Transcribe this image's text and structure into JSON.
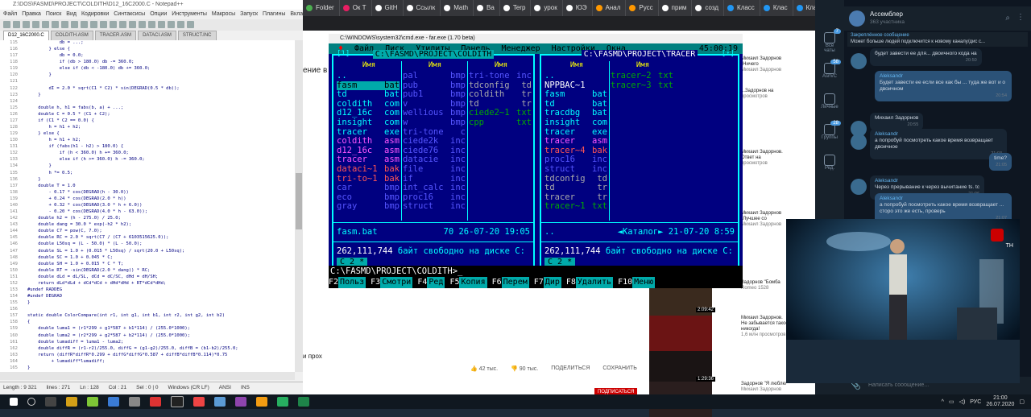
{
  "editor": {
    "title": "Z:\\DOS\\FASMD\\PROJECT\\COLDITH\\D12_16C2000.C - Notepad++",
    "menu": [
      "Файл",
      "Правка",
      "Поиск",
      "Вид",
      "Кодировки",
      "Синтаксисы",
      "Опции",
      "Инструменты",
      "Макросы",
      "Запуск",
      "Плагины",
      "Вкладки",
      "?"
    ],
    "tabs": [
      "D12_16C2000.C",
      "COLDITH.ASM",
      "TRACER.ASM",
      "DATACI.ASM",
      "STRUCT.INC"
    ],
    "lines": [
      {
        "n": "115",
        "t": "            db = ...;"
      },
      {
        "n": "116",
        "t": "        } else {"
      },
      {
        "n": "117",
        "t": "            db = 0.0;"
      },
      {
        "n": "118",
        "t": "            if (db > 180.0) db -= 360.0;"
      },
      {
        "n": "119",
        "t": "            else if (db < -180.0) db += 360.0;"
      },
      {
        "n": "120",
        "t": "        }"
      },
      {
        "n": "121",
        "t": ""
      },
      {
        "n": "122",
        "t": "        dI = 2.0 * sqrt(C1 * C2) * sin(DEGRAD(0.5 * db));"
      },
      {
        "n": "123",
        "t": "    }"
      },
      {
        "n": "124",
        "t": ""
      },
      {
        "n": "125",
        "t": "    double h, h1 = fabs(b, a) + ...;"
      },
      {
        "n": "126",
        "t": "    double C = 0.5 * (C1 + C2);"
      },
      {
        "n": "127",
        "t": "    if (C1 * C2 == 0.0) {"
      },
      {
        "n": "128",
        "t": "        h = h1 + h2;"
      },
      {
        "n": "129",
        "t": "    } else {"
      },
      {
        "n": "130",
        "t": "        h = h1 + h2;"
      },
      {
        "n": "131",
        "t": "        if (fabs(h1 - h2) > 180.0) {"
      },
      {
        "n": "132",
        "t": "            if (h < 360.0) h += 360.0;"
      },
      {
        "n": "133",
        "t": "            else if (h >= 360.0) h -= 360.0;"
      },
      {
        "n": "134",
        "t": "        }"
      },
      {
        "n": "135",
        "t": "        h *= 0.5;"
      },
      {
        "n": "136",
        "t": "    }"
      },
      {
        "n": "137",
        "t": "    double T = 1.0"
      },
      {
        "n": "138",
        "t": "        - 0.17 * cos(DEGRAD(h - 30.0))"
      },
      {
        "n": "139",
        "t": "        + 0.24 * cos(DEGRAD(2.0 * h))"
      },
      {
        "n": "140",
        "t": "        + 0.32 * cos(DEGRAD(3.0 * h + 6.0))"
      },
      {
        "n": "141",
        "t": "        - 0.20 * cos(DEGRAD(4.0 * h - 63.0));"
      },
      {
        "n": "142",
        "t": "    double h2 = (h - 275.0) / 25.0;"
      },
      {
        "n": "143",
        "t": "    double dang = 30.0 * exp(-h2 * h2);"
      },
      {
        "n": "144",
        "t": "    double C7 = pow(C, 7.0);"
      },
      {
        "n": "145",
        "t": "    double RC = 2.0 * sqrt(C7 / (C7 + 6103515625.0));"
      },
      {
        "n": "146",
        "t": "    double L50sq = (L - 50.0) * (L - 50.0);"
      },
      {
        "n": "147",
        "t": "    double SL = 1.0 + (0.015 * L50sq) / sqrt(20.0 + L50sq);"
      },
      {
        "n": "148",
        "t": "    double SC = 1.0 + 0.045 * C;"
      },
      {
        "n": "149",
        "t": "    double SH = 1.0 + 0.015 * C * T;"
      },
      {
        "n": "150",
        "t": "    double RT = -sin(DEGRAD(2.0 * dang)) * RC;"
      },
      {
        "n": "151",
        "t": "    double dLd = dL/SL, dCd = dC/SC, dHd = dH/SH;"
      },
      {
        "n": "152",
        "t": "    return dLd*dLd + dCd*dCd + dHd*dHd + RT*dCd*dHd;"
      },
      {
        "n": "153",
        "t": "#undef RADDEG"
      },
      {
        "n": "154",
        "t": "#undef DEGRAD"
      },
      {
        "n": "155",
        "t": "}"
      },
      {
        "n": "156",
        "t": ""
      },
      {
        "n": "157",
        "t": "static double ColorCompare(int r1, int g1, int b1, int r2, int g2, int b2)"
      },
      {
        "n": "158",
        "t": "{"
      },
      {
        "n": "159",
        "t": "    double luma1 = (r1*299 + g1*587 + b1*114) / (255.0*1000);"
      },
      {
        "n": "160",
        "t": "    double luma2 = (r2*299 + g2*587 + b2*114) / (255.0*1000);"
      },
      {
        "n": "161",
        "t": "    double lumadiff = luma1 - luma2;"
      },
      {
        "n": "162",
        "t": "    double diffR = (r1-r2)/255.0, diffG = (g1-g2)/255.0, diffB = (b1-b2)/255.0;"
      },
      {
        "n": "163",
        "t": "    return (diffR*diffR*0.299 + diffG*diffG*0.587 + diffB*diffB*0.114)*0.75"
      },
      {
        "n": "164",
        "t": "         + lumadiff*lumadiff;"
      },
      {
        "n": "165",
        "t": "}"
      }
    ],
    "status": [
      "Length : 9 321",
      "lines : 271",
      "Ln : 128",
      "Col : 21",
      "Sel : 0 | 0",
      "Windows (CR LF)",
      "ANSI",
      "INS"
    ]
  },
  "browser": {
    "tabs": [
      {
        "label": "Folder",
        "color": "#4caf50"
      },
      {
        "label": "Ок Т",
        "color": "#e91e63"
      },
      {
        "label": "GitH",
        "color": "#fff"
      },
      {
        "label": "Ссылк",
        "color": "#fff"
      },
      {
        "label": "Math",
        "color": "#fff"
      },
      {
        "label": "Ва",
        "color": "#fff"
      },
      {
        "label": "Terp",
        "color": "#fff"
      },
      {
        "label": "урок",
        "color": "#fff"
      },
      {
        "label": "ЮЭ",
        "color": "#fff"
      },
      {
        "label": "Анал",
        "color": "#ff9800"
      },
      {
        "label": "Русс",
        "color": "#ff9800"
      },
      {
        "label": "прим",
        "color": "#fff"
      },
      {
        "label": "созд",
        "color": "#fff"
      },
      {
        "label": "Класс",
        "color": "#2196f3"
      },
      {
        "label": "Клас",
        "color": "#2196f3"
      },
      {
        "label": "Класс",
        "color": "#2196f3"
      },
      {
        "label": "учеб",
        "color": "#fff"
      },
      {
        "label": "Кл",
        "color": "#2196f3"
      }
    ],
    "page_fragment": "ение в",
    "below_text": "и прох",
    "likes": "42 тыс.",
    "dislikes": "90 тыс.",
    "share": "ПОДЕЛИТЬСЯ",
    "save": "СОХРАНИТЬ",
    "subscribe": "ПОДПИСАТЬСЯ"
  },
  "far": {
    "window_title": "C:\\WINDOWS\\system32\\cmd.exe - far.exe (1.70 beta)",
    "menu": [
      "Файл",
      "Диск",
      "Утилиты",
      "Панель",
      "Менеджер",
      "Настройки",
      "Окна"
    ],
    "clock": "45:00:19",
    "left": {
      "path": "C:\\FASMD\\PROJECT\\COLDITH",
      "corner_left": "[1]",
      "col_header": "Имя",
      "columns": [
        [
          {
            "name": "..",
            "ext": "",
            "color": "#00ffff"
          },
          {
            "name": "fasm",
            "ext": "bat",
            "color": "#000000",
            "selected": true
          },
          {
            "name": "td",
            "ext": "bat",
            "color": "#00ffff"
          },
          {
            "name": "coldith",
            "ext": "com",
            "color": "#00ffff"
          },
          {
            "name": "d12_16c",
            "ext": "com",
            "color": "#00ffff"
          },
          {
            "name": "insight",
            "ext": "com",
            "color": "#00ffff"
          },
          {
            "name": "tracer",
            "ext": "exe",
            "color": "#00ffff"
          },
          {
            "name": "coldith",
            "ext": "asm",
            "color": "#ff55ff"
          },
          {
            "name": "d12_16c",
            "ext": "asm",
            "color": "#ff55ff"
          },
          {
            "name": "tracer",
            "ext": "asm",
            "color": "#ff55ff"
          },
          {
            "name": "dataci~1",
            "ext": "bak",
            "color": "#ff5555"
          },
          {
            "name": "tri-to~1",
            "ext": "bak",
            "color": "#ff5555"
          },
          {
            "name": "car",
            "ext": "bmp",
            "color": "#5555ff"
          },
          {
            "name": "eco",
            "ext": "bmp",
            "color": "#5555ff"
          },
          {
            "name": "gray",
            "ext": "bmp",
            "color": "#5555ff"
          }
        ],
        [
          {
            "name": "pal",
            "ext": "bmp",
            "color": "#5555ff"
          },
          {
            "name": "pub",
            "ext": "bmp",
            "color": "#5555ff"
          },
          {
            "name": "pub1",
            "ext": "bmp",
            "color": "#5555ff"
          },
          {
            "name": "v",
            "ext": "bmp",
            "color": "#5555ff"
          },
          {
            "name": "wellious",
            "ext": "bmp",
            "color": "#5555ff"
          },
          {
            "name": "w",
            "ext": "bmp",
            "color": "#5555ff"
          },
          {
            "name": "tri-tone",
            "ext": "c",
            "color": "#5555ff"
          },
          {
            "name": "ciede2k",
            "ext": "inc",
            "color": "#5555ff"
          },
          {
            "name": "ciede76",
            "ext": "inc",
            "color": "#5555ff"
          },
          {
            "name": "datacie",
            "ext": "inc",
            "color": "#5555ff"
          },
          {
            "name": "file",
            "ext": "inc",
            "color": "#5555ff"
          },
          {
            "name": "if",
            "ext": "inc",
            "color": "#5555ff"
          },
          {
            "name": "int_calc",
            "ext": "inc",
            "color": "#5555ff"
          },
          {
            "name": "proc16",
            "ext": "inc",
            "color": "#5555ff"
          },
          {
            "name": "struct",
            "ext": "inc",
            "color": "#5555ff"
          }
        ],
        [
          {
            "name": "tri-tone",
            "ext": "inc",
            "color": "#5555ff"
          },
          {
            "name": "tdconfig",
            "ext": "td",
            "color": "#aaaaaa"
          },
          {
            "name": "coldith",
            "ext": "tr",
            "color": "#aaaaaa"
          },
          {
            "name": "td",
            "ext": "tr",
            "color": "#aaaaaa"
          },
          {
            "name": "ciede2~1",
            "ext": "txt",
            "color": "#00aa00"
          },
          {
            "name": "cpp",
            "ext": "txt",
            "color": "#00aa00"
          }
        ]
      ],
      "info_name": "fasm.bat",
      "info_size": "70",
      "info_date": "26-07-20",
      "info_time": "19:05",
      "free_bytes": "262,111,744",
      "free_label": "байт свободно на диске C:",
      "selection": "C 2 *"
    },
    "right": {
      "path": "C:\\FASMD\\PROJECT\\TRACER",
      "corner_right": "[↑]",
      "col_header": "Имя",
      "columns": [
        [
          {
            "name": "..",
            "ext": "",
            "color": "#00ffff"
          },
          {
            "name": "NPPBAC~1",
            "ext": "",
            "color": "#ffffff"
          },
          {
            "name": "fasm",
            "ext": "bat",
            "color": "#00ffff"
          },
          {
            "name": "td",
            "ext": "bat",
            "color": "#00ffff"
          },
          {
            "name": "tracdbg",
            "ext": "bat",
            "color": "#00ffff"
          },
          {
            "name": "insight",
            "ext": "com",
            "color": "#00ffff"
          },
          {
            "name": "tracer",
            "ext": "exe",
            "color": "#00ffff"
          },
          {
            "name": "tracer",
            "ext": "asm",
            "color": "#ff55ff"
          },
          {
            "name": "tracer~4",
            "ext": "bak",
            "color": "#ff5555"
          },
          {
            "name": "proc16",
            "ext": "inc",
            "color": "#5555ff"
          },
          {
            "name": "struct",
            "ext": "inc",
            "color": "#5555ff"
          },
          {
            "name": "tdconfig",
            "ext": "td",
            "color": "#aaaaaa"
          },
          {
            "name": "td",
            "ext": "tr",
            "color": "#aaaaaa"
          },
          {
            "name": "tracer",
            "ext": "tr",
            "color": "#aaaaaa"
          },
          {
            "name": "tracer~1",
            "ext": "txt",
            "color": "#00aa00"
          }
        ],
        [
          {
            "name": "tracer~2",
            "ext": "txt",
            "color": "#00aa00"
          },
          {
            "name": "tracer~3",
            "ext": "txt",
            "color": "#00aa00"
          }
        ]
      ],
      "info_name": "..",
      "info_size": "◄Каталог►",
      "info_date": "21-07-20",
      "info_time": "8:59",
      "free_bytes": "262,111,744",
      "free_label": "байт свободно на диске C:",
      "selection": "C 2 *"
    },
    "command_line": "C:\\FASMD\\PROJECT\\COLDITH>_",
    "keys": [
      {
        "n": "F2",
        "t": "Польз"
      },
      {
        "n": "F3",
        "t": "Смотри"
      },
      {
        "n": "F4",
        "t": "Ред"
      },
      {
        "n": "F5",
        "t": "Копия"
      },
      {
        "n": "F6",
        "t": "Перем"
      },
      {
        "n": "F7",
        "t": "Дир"
      },
      {
        "n": "F8",
        "t": "Удалить"
      },
      {
        "n": "F10",
        "t": "Меню"
      }
    ]
  },
  "youtube_side": {
    "items": [
      {
        "title": "Михаил Задорнов \"Ничего",
        "meta": "Михаил Задорнов"
      },
      {
        "title": "...Задорнов на",
        "meta": "просмотров"
      },
      {
        "title": "Михаил Задорнов. Ответ на",
        "meta": "просмотров"
      },
      {
        "title": "Михаил Задорнов \"Лучшее со",
        "meta": "Михаил Задорнов"
      },
      {
        "title": "Задорнов \"Бомба",
        "meta": "Romeo 1528"
      },
      {
        "title": "Михаил Задорнов. Не забывается такое никогда!",
        "meta": "1,6 млн просмотров"
      },
      {
        "title": "Задорнов \"Я люблю",
        "meta": "Михаил Задорнов"
      }
    ],
    "durations": [
      "2:09:42",
      "1:29:36"
    ]
  },
  "telegram": {
    "channel": "Ассемблер",
    "members": "363 участника",
    "pinned_label": "Закреплённое сообщение",
    "pinned_text": "Может больше людей подключится к новому каналу/дис с...",
    "rail": [
      "Все чаты",
      "Asm/C",
      "Личные",
      "Группы",
      "Ред."
    ],
    "rail_badges": [
      "7",
      "58",
      "",
      "28",
      ""
    ],
    "messages": [
      {
        "name": "",
        "text": "будет завести ее для... двоичного кода на",
        "time": "20:50",
        "out": false
      },
      {
        "name": "Aleksandr",
        "text": "Будет завести ее если все как бы ... туда же вот и о двоичном",
        "time": "20:54",
        "out": true
      },
      {
        "name": "",
        "text": "Михаил Задорнов",
        "time": "20:55",
        "out": false
      },
      {
        "name": "Aleksandr",
        "text": "а попробуй посмотреть какое время возвращает двоичное",
        "time": "21:03",
        "out": false
      },
      {
        "name": "",
        "text": "time?",
        "time": "21:05",
        "out": true
      },
      {
        "name": "Aleksandr",
        "text": "Через прерывание к через вычитание ts. tc",
        "time": "21:06",
        "out": false
      },
      {
        "name": "Aleksandr",
        "text": "а попробуй посмотреть какое время возвращает ... сторо это же есть, проверь",
        "time": "21:07",
        "out": true
      }
    ],
    "input_placeholder": "Написать сообщение..."
  },
  "video": {
    "badge": "ТН"
  },
  "taskbar": {
    "lang": "РУС",
    "time": "21:00",
    "date": "26.07.2020"
  }
}
